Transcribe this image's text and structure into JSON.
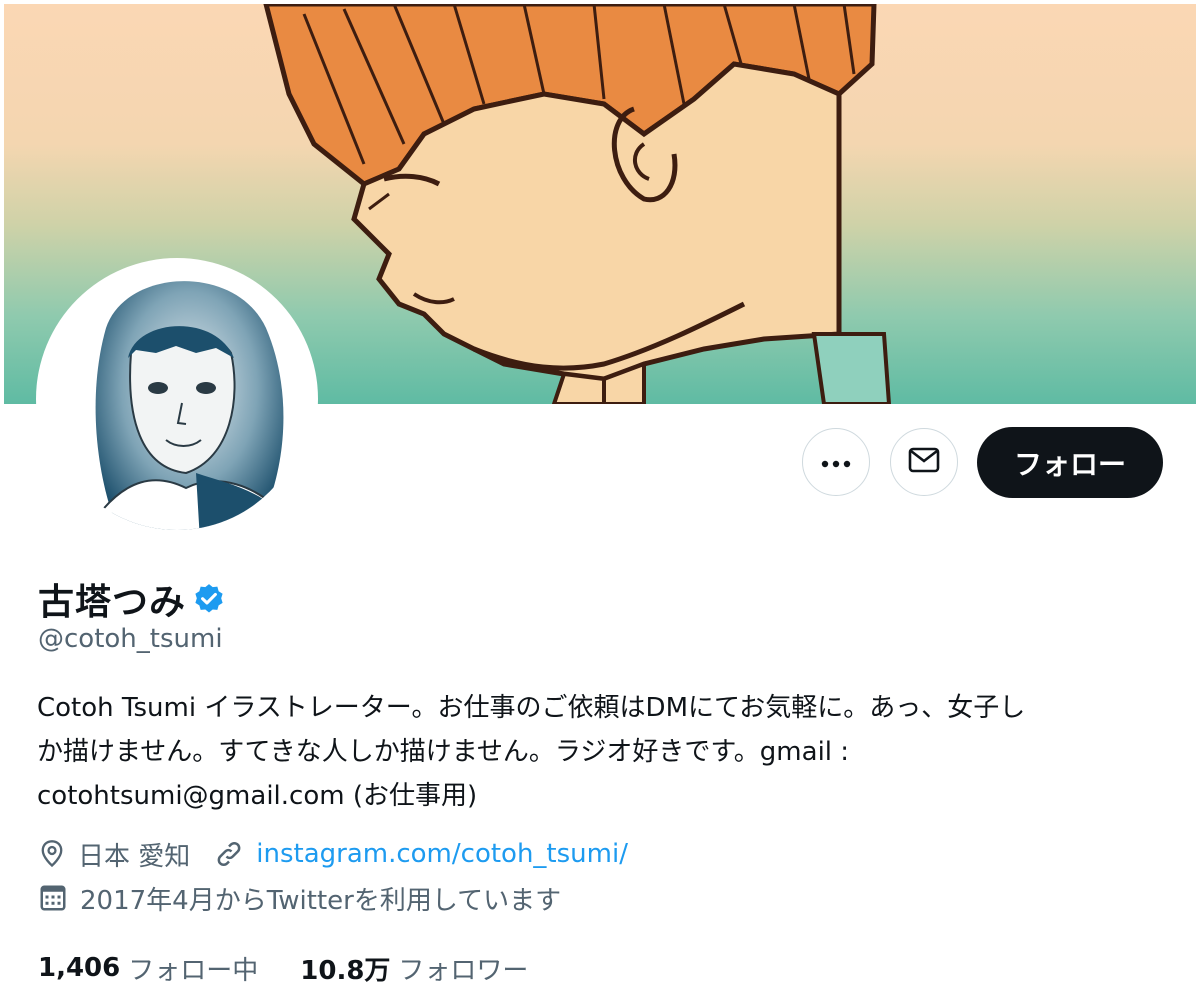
{
  "profile": {
    "name": "古塔つみ",
    "handle": "@cotoh_tsumi",
    "bio_line1": "Cotoh Tsumi  イラストレーター。お仕事のご依頼はDMにてお気軽に。あっ、女子し",
    "bio_line2": "か描けません。すてきな人しか描けません。ラジオ好きです。gmail :",
    "bio_line3": "cotohtsumi@gmail.com (お仕事用)",
    "location": "日本 愛知",
    "website": "instagram.com/cotoh_tsumi/",
    "joined": "2017年4月からTwitterを利用しています",
    "verified_icon": "verified-badge-icon"
  },
  "actions": {
    "more_icon": "more-icon",
    "dm_icon": "mail-icon",
    "follow_label": "フォロー"
  },
  "stats": {
    "following_count": "1,406",
    "following_label": "フォロー中",
    "followers_count": "10.8万",
    "followers_label": "フォロワー"
  },
  "colors": {
    "accent": "#1d9bf0",
    "text_primary": "#0f1419",
    "text_secondary": "#536471",
    "follow_button_bg": "#0f1419"
  }
}
